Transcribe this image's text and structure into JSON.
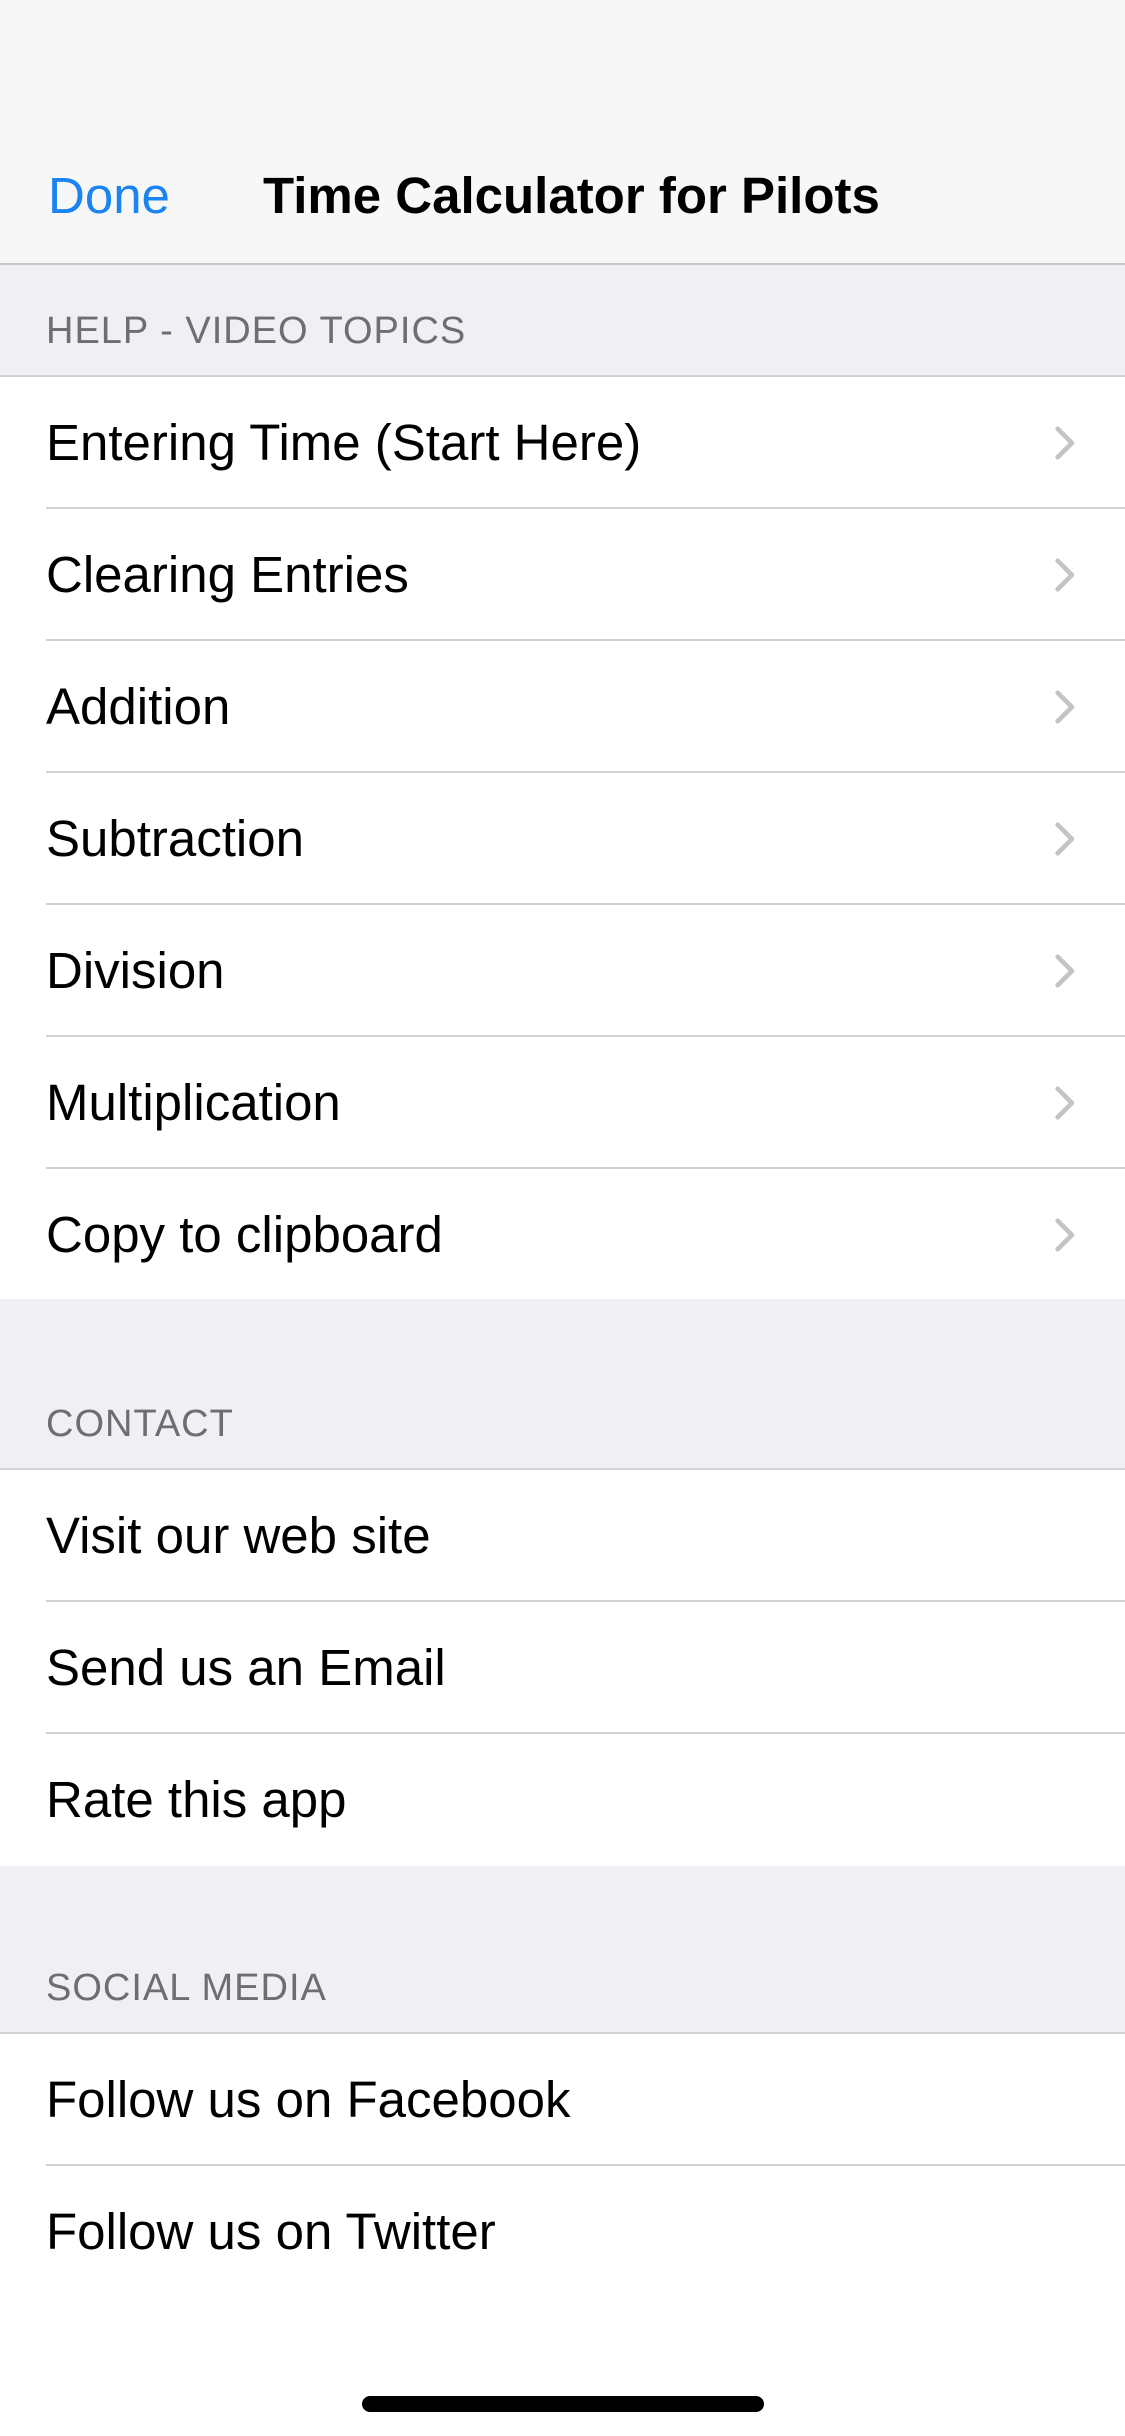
{
  "navbar": {
    "done_label": "Done",
    "title": "Time Calculator for Pilots"
  },
  "sections": {
    "help": {
      "header": "HELP - VIDEO TOPICS",
      "items": [
        {
          "label": "Entering Time (Start Here)",
          "icon": "chevron-right-icon"
        },
        {
          "label": "Clearing Entries",
          "icon": "chevron-right-icon"
        },
        {
          "label": "Addition",
          "icon": "chevron-right-icon"
        },
        {
          "label": "Subtraction",
          "icon": "chevron-right-icon"
        },
        {
          "label": "Division",
          "icon": "chevron-right-icon"
        },
        {
          "label": "Multiplication",
          "icon": "chevron-right-icon"
        },
        {
          "label": "Copy to clipboard",
          "icon": "chevron-right-icon"
        }
      ]
    },
    "contact": {
      "header": "CONTACT",
      "items": [
        {
          "label": "Visit our web site"
        },
        {
          "label": "Send us an Email"
        },
        {
          "label": "Rate this app"
        }
      ]
    },
    "social": {
      "header": "SOCIAL MEDIA",
      "items": [
        {
          "label": "Follow us on Facebook"
        },
        {
          "label": "Follow us on Twitter"
        }
      ]
    }
  },
  "colors": {
    "accent": "#1a84f2",
    "grouped_background": "#efeff4",
    "section_header_text": "#6d6d72",
    "separator": "#d2d2d6",
    "chevron": "#c4c4c7"
  }
}
